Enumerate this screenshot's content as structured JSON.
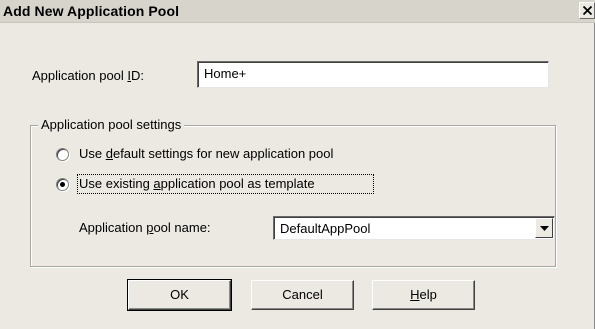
{
  "dialog": {
    "title": "Add New Application Pool",
    "close_icon": "close-icon",
    "pool_id": {
      "label_before": "Application pool ",
      "label_accel": "I",
      "label_after": "D:",
      "value": "Home+"
    },
    "settings_group": {
      "legend": "Application pool settings",
      "option_default": {
        "before": "Use ",
        "accel": "d",
        "after": "efault settings for new application pool",
        "selected": false
      },
      "option_existing": {
        "before": "Use existing ",
        "accel": "a",
        "after": "pplication pool as template",
        "selected": true
      },
      "pool_name": {
        "label_before": "Application ",
        "label_accel": "p",
        "label_after": "ool name:",
        "value": "DefaultAppPool",
        "arrow_icon": "chevron-down-icon"
      }
    },
    "buttons": {
      "ok": "OK",
      "cancel": "Cancel",
      "help_accel": "H",
      "help_rest": "elp"
    }
  }
}
